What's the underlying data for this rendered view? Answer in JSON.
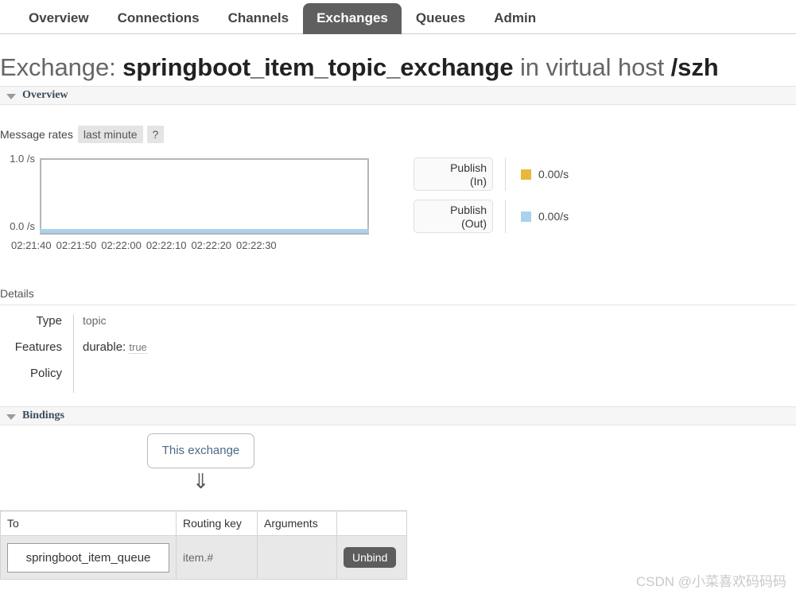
{
  "nav": {
    "items": [
      {
        "label": "Overview",
        "active": false
      },
      {
        "label": "Connections",
        "active": false
      },
      {
        "label": "Channels",
        "active": false
      },
      {
        "label": "Exchanges",
        "active": true
      },
      {
        "label": "Queues",
        "active": false
      },
      {
        "label": "Admin",
        "active": false
      }
    ]
  },
  "page": {
    "title_prefix": "Exchange: ",
    "exchange_name": "springboot_item_topic_exchange",
    "title_middle": " in virtual host ",
    "vhost": "/szh"
  },
  "sections": {
    "overview_label": "Overview",
    "bindings_label": "Bindings"
  },
  "rates": {
    "label": "Message rates",
    "period_button": "last minute",
    "help_button": "?"
  },
  "chart_data": {
    "type": "line",
    "title": "Message rates",
    "xlabel": "",
    "ylabel": "/s",
    "ylim": [
      0.0,
      1.0
    ],
    "y_ticks": [
      "0.0 /s",
      "1.0 /s"
    ],
    "y_top_label": "1.0 /s",
    "y_bottom_label": "0.0 /s",
    "grid": false,
    "legend_position": "right",
    "x": [
      "02:21:40",
      "02:21:50",
      "02:22:00",
      "02:22:10",
      "02:22:20",
      "02:22:30"
    ],
    "series": [
      {
        "name": "Publish (In)",
        "color": "#e8b73c",
        "current_value": "0.00/s",
        "values": [
          0.0,
          0.0,
          0.0,
          0.0,
          0.0,
          0.0
        ]
      },
      {
        "name": "Publish (Out)",
        "color": "#a9d2ed",
        "current_value": "0.00/s",
        "values": [
          0.0,
          0.0,
          0.0,
          0.0,
          0.0,
          0.0
        ]
      }
    ]
  },
  "legend": [
    {
      "line1": "Publish",
      "line2": "(In)",
      "color": "#e8b73c",
      "value": "0.00/s"
    },
    {
      "line1": "Publish",
      "line2": "(Out)",
      "color": "#a9d2ed",
      "value": "0.00/s"
    }
  ],
  "details": {
    "heading": "Details",
    "rows": [
      {
        "key": "Type",
        "value": "topic",
        "extra": ""
      },
      {
        "key": "Features",
        "value": "durable:",
        "extra": "true"
      },
      {
        "key": "Policy",
        "value": "",
        "extra": ""
      }
    ]
  },
  "bindings": {
    "source_box": "This exchange",
    "arrow": "⇓",
    "columns": [
      "To",
      "Routing key",
      "Arguments",
      ""
    ],
    "rows": [
      {
        "to": "springboot_item_queue",
        "routing_key": "item.#",
        "arguments": "",
        "action": "Unbind"
      }
    ]
  },
  "watermark": "CSDN @小菜喜欢码码码"
}
